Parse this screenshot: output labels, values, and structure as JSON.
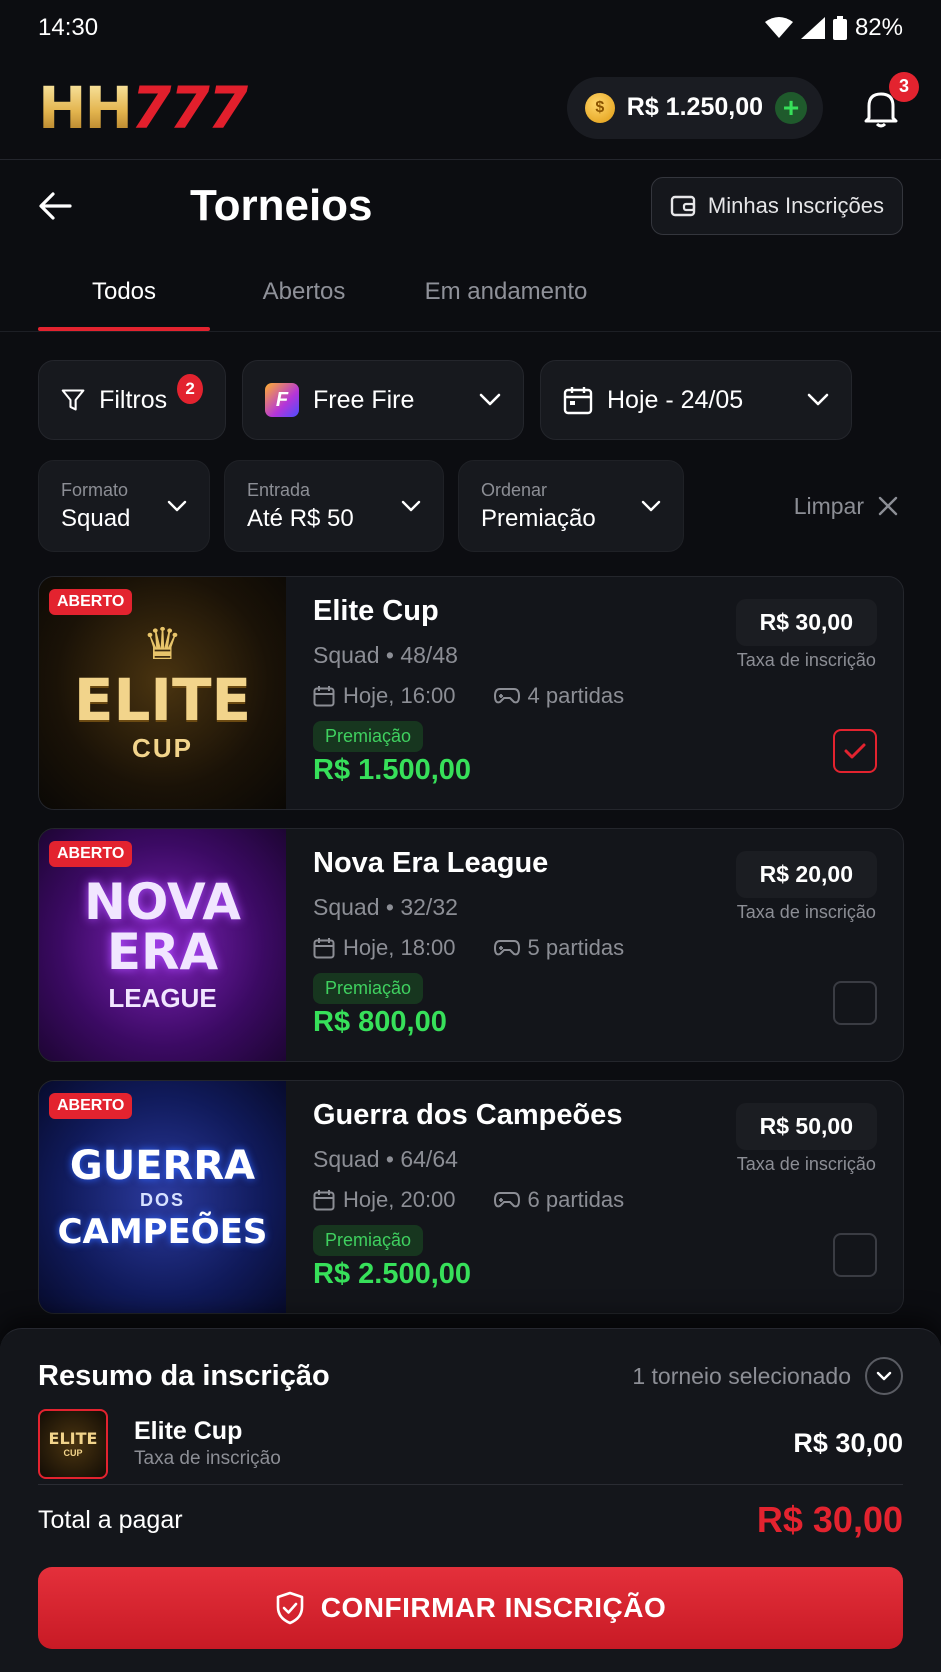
{
  "status_bar": {
    "time": "14:30",
    "battery": "82%"
  },
  "header": {
    "logo_hh": "HH",
    "logo_777": "777",
    "balance": "R$ 1.250,00",
    "notifications_count": "3"
  },
  "page": {
    "title": "Torneios",
    "my_registrations": "Minhas Inscrições"
  },
  "tabs": [
    {
      "label": "Todos",
      "active": true
    },
    {
      "label": "Abertos",
      "active": false
    },
    {
      "label": "Em andamento",
      "active": false
    }
  ],
  "filters": {
    "filters_label": "Filtros",
    "filters_count": "2",
    "game": "Free Fire",
    "game_icon_letter": "F",
    "date": "Hoje - 24/05",
    "format_label": "Formato",
    "format_value": "Squad",
    "entry_label": "Entrada",
    "entry_value": "Até R$ 50",
    "sort_label": "Ordenar",
    "sort_value": "Premiação",
    "clear": "Limpar"
  },
  "tournaments": [
    {
      "badge": "ABERTO",
      "art_top": "ELITE",
      "art_bottom": "CUP",
      "name": "Elite Cup",
      "meta": "Squad • 48/48",
      "time": "Hoje, 16:00",
      "matches": "4 partidas",
      "prize_label": "Premiação",
      "prize": "R$ 1.500,00",
      "fee": "R$ 30,00",
      "fee_label": "Taxa de inscrição",
      "selected": true
    },
    {
      "badge": "ABERTO",
      "art_top": "NOVA",
      "art_mid": "ERA",
      "art_bottom": "LEAGUE",
      "name": "Nova Era League",
      "meta": "Squad • 32/32",
      "time": "Hoje, 18:00",
      "matches": "5 partidas",
      "prize_label": "Premiação",
      "prize": "R$ 800,00",
      "fee": "R$ 20,00",
      "fee_label": "Taxa de inscrição",
      "selected": false
    },
    {
      "badge": "ABERTO",
      "art_top": "GUERRA",
      "art_mid": "DOS",
      "art_bottom": "CAMPEÕES",
      "name": "Guerra dos Campeões",
      "meta": "Squad • 64/64",
      "time": "Hoje, 20:00",
      "matches": "6 partidas",
      "prize_label": "Premiação",
      "prize": "R$ 2.500,00",
      "fee": "R$ 50,00",
      "fee_label": "Taxa de inscrição",
      "selected": false
    }
  ],
  "summary": {
    "title": "Resumo da inscrição",
    "count": "1 torneio selecionado",
    "item_name": "Elite Cup",
    "item_sub": "Taxa de inscrição",
    "item_price": "R$ 30,00",
    "item_art_top": "ELITE",
    "item_art_bottom": "CUP",
    "total_label": "Total a pagar",
    "total_value": "R$ 30,00",
    "confirm": "CONFIRMAR INSCRIÇÃO"
  },
  "colors": {
    "accent": "#e3232f",
    "prize": "#37e05a",
    "background": "#0c0d11"
  }
}
